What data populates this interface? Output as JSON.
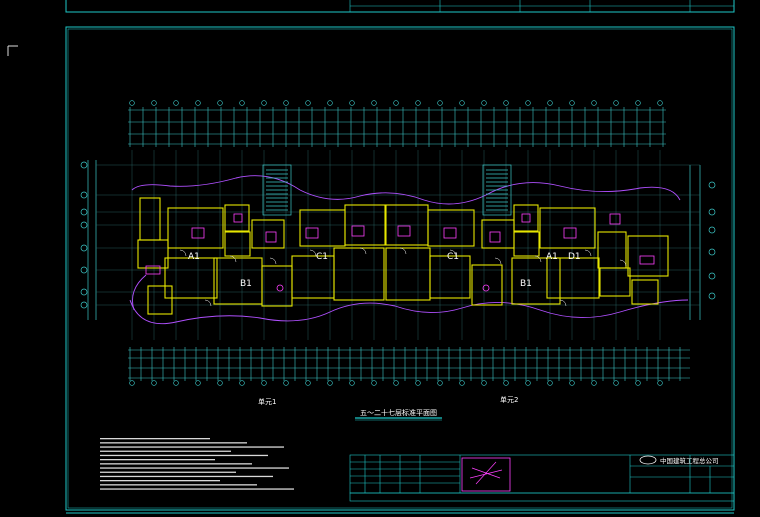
{
  "drawing": {
    "title": "五～二十七层标准平面图",
    "unit_labels": [
      "单元1",
      "单元2"
    ],
    "room_labels": [
      "A1",
      "B1",
      "C1",
      "C1",
      "B1",
      "A1",
      "D1"
    ],
    "company_name": "中国建筑工程总公司",
    "colors": {
      "background": "#000000",
      "frame": "#1ec8c8",
      "walls": "#e6e600",
      "dims": "#3cc8c8",
      "pink": "#ff40ff",
      "white": "#ffffff",
      "title": "#ffffff"
    }
  }
}
